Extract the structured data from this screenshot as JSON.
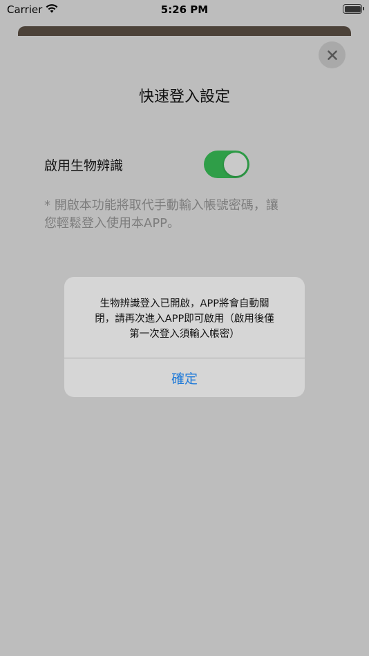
{
  "status_bar": {
    "carrier": "Carrier",
    "time": "5:26 PM"
  },
  "sheet": {
    "title": "快速登入設定",
    "biometric_label": "啟用生物辨識",
    "biometric_enabled": true,
    "note_lines": [
      "* 開啟本功能將取代手動輸入帳號密碼，讓",
      "您輕鬆登入使用本APP。"
    ]
  },
  "alert": {
    "message_lines": [
      "生物辨識登入已開啟，APP將會自動關",
      "閉，請再次進入APP即可啟用（啟用後僅",
      "第一次登入須輸入帳密）"
    ],
    "confirm_label": "確定"
  },
  "colors": {
    "toggle_on": "#2f9e48",
    "link_blue": "#1f7ad8"
  },
  "icons": {
    "close": "close-icon",
    "wifi": "wifi-icon",
    "battery": "battery-icon"
  }
}
